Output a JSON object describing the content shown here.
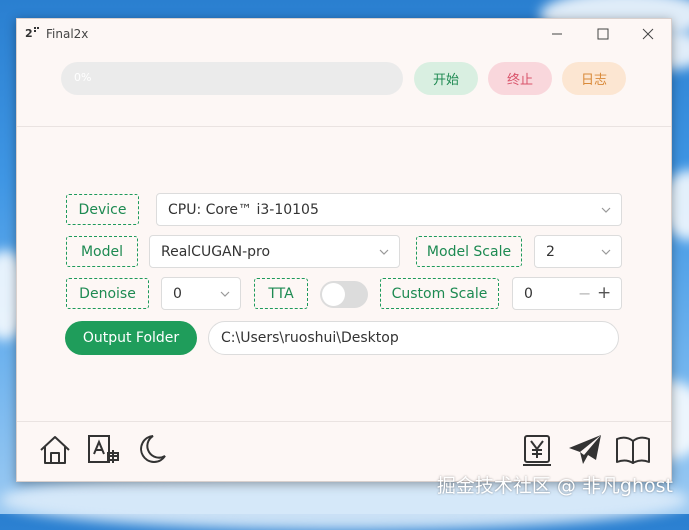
{
  "window": {
    "title": "Final2x"
  },
  "toolbar": {
    "progress_text": "0%",
    "start_label": "开始",
    "stop_label": "终止",
    "log_label": "日志"
  },
  "settings": {
    "device_label": "Device",
    "device_value": "CPU: Core™ i3-10105",
    "model_label": "Model",
    "model_value": "RealCUGAN-pro",
    "model_scale_label": "Model Scale",
    "model_scale_value": "2",
    "denoise_label": "Denoise",
    "denoise_value": "0",
    "tta_label": "TTA",
    "tta_enabled": false,
    "custom_scale_label": "Custom Scale",
    "custom_scale_value": "0",
    "output_folder_label": "Output Folder",
    "output_folder_value": "C:\\Users\\ruoshui\\Desktop"
  },
  "footer_icons": [
    "home-icon",
    "translate-icon",
    "moon-icon",
    "yen-donate-icon",
    "send-icon",
    "book-icon"
  ],
  "watermark": "掘金技术社区 @ 非凡ghost",
  "colors": {
    "accent_green": "#1f9d5b",
    "start_bg": "#d9efe1",
    "stop_bg": "#f9d7dc",
    "log_bg": "#fce6d2"
  }
}
